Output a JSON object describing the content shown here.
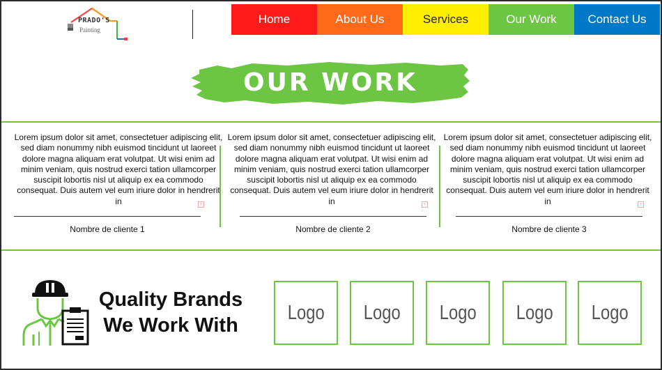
{
  "brand": {
    "name": "PRADO'S",
    "sub": "Painting"
  },
  "nav": [
    {
      "label": "Home",
      "color": "#ff1a1a"
    },
    {
      "label": "About Us",
      "color": "#ff6a1a"
    },
    {
      "label": "Services",
      "color": "#ffee00"
    },
    {
      "label": "Our Work",
      "color": "#6cc644"
    },
    {
      "label": "Contact Us",
      "color": "#0078c8"
    }
  ],
  "banner": {
    "title": "OUR WORK",
    "color": "#6cc644"
  },
  "testimonials": [
    {
      "text": "Lorem ipsum dolor sit amet, consectetuer adipiscing elit, sed diam nonummy nibh euismod tincidunt ut laoreet dolore magna aliquam erat volutpat. Ut wisi enim ad minim veniam, quis nostrud exerci tation ullamcorper suscipit lobortis nisl ut aliquip ex ea commodo consequat. Duis autem vel eum iriure dolor in hendrerit in",
      "client": "Nombre de cliente 1"
    },
    {
      "text": "Lorem ipsum dolor sit amet, consectetuer adipiscing elit, sed diam nonummy nibh euismod tincidunt ut laoreet dolore magna aliquam erat volutpat. Ut wisi enim ad minim veniam, quis nostrud exerci tation ullamcorper suscipit lobortis nisl ut aliquip ex ea commodo consequat. Duis autem vel eum iriure dolor in hendrerit in",
      "client": "Nombre de cliente 2"
    },
    {
      "text": "Lorem ipsum dolor sit amet, consectetuer adipiscing elit, sed diam nonummy nibh euismod tincidunt ut laoreet dolore magna aliquam erat volutpat. Ut wisi enim ad minim veniam, quis nostrud exerci tation ullamcorper suscipit lobortis nisl ut aliquip ex ea commodo consequat. Duis autem vel eum iriure dolor in hendrerit in",
      "client": "Nombre de cliente 3"
    }
  ],
  "brands": {
    "title_line1": "Quality Brands",
    "title_line2": "We Work With",
    "logos": [
      "Logo",
      "Logo",
      "Logo",
      "Logo",
      "Logo"
    ]
  },
  "colors": {
    "accent": "#6cc644"
  },
  "icons": {
    "worker": "worker-with-clipboard-icon",
    "logo": "house-paint-logo-icon",
    "expand": "expand-icon"
  }
}
